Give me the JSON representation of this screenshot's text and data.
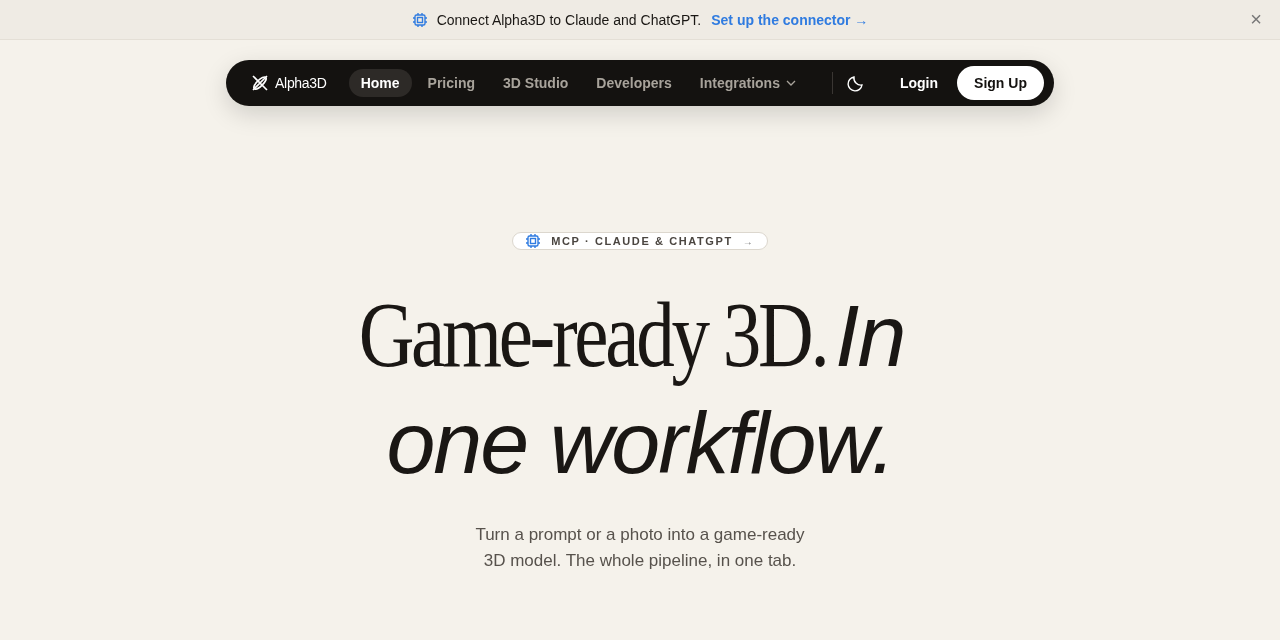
{
  "banner": {
    "text": "Connect Alpha3D to Claude and ChatGPT.",
    "link": "Set up the connector →",
    "close": "×"
  },
  "nav": {
    "logo": "Alpha3D",
    "items": [
      {
        "label": "Home",
        "selected": true,
        "has_menu": false
      },
      {
        "label": "Pricing",
        "selected": false,
        "has_menu": false
      },
      {
        "label": "3D Studio",
        "selected": false,
        "has_menu": false
      },
      {
        "label": "Developers",
        "selected": false,
        "has_menu": false
      },
      {
        "label": "Integrations",
        "selected": false,
        "has_menu": true
      }
    ],
    "actions": [
      {
        "label": "Login",
        "kind": "text"
      },
      {
        "label": "Sign Up",
        "kind": "filled"
      }
    ]
  },
  "hero": {
    "pill": "MCP · CLAUDE & CHATGPT",
    "pill_arrow": "→",
    "title_serif": "Game-ready 3D.",
    "title_italic": "In one workflow.",
    "subtitle": "Turn a prompt or a photo into a game-ready 3D model. The whole pipeline, in one tab."
  }
}
